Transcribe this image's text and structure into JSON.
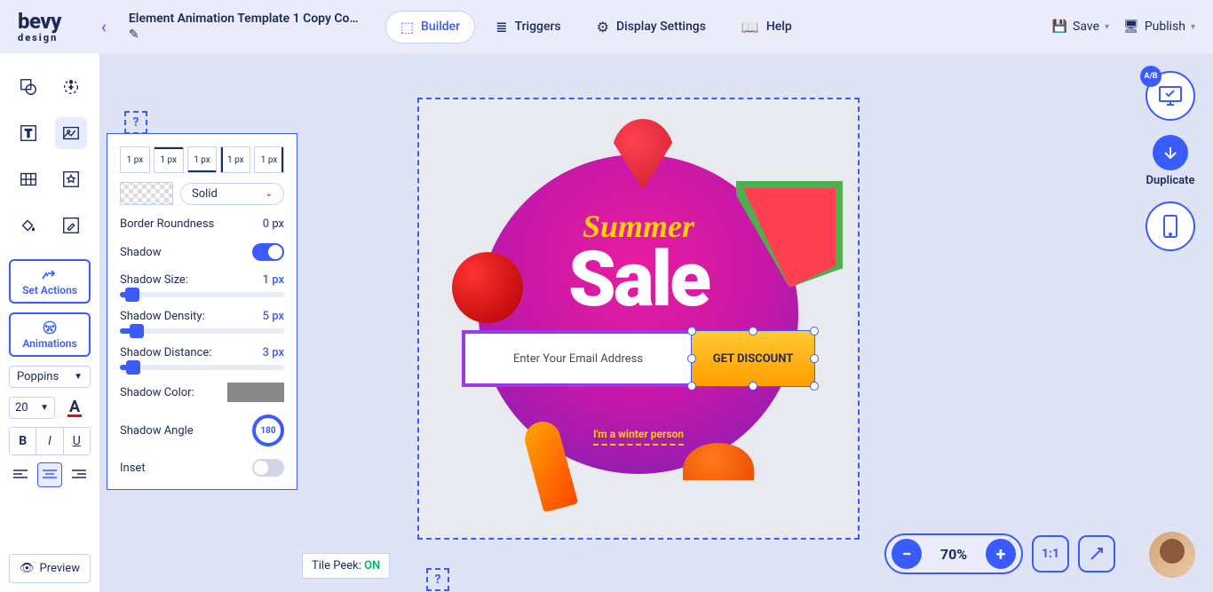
{
  "logo": {
    "top": "bevy",
    "sub": "design"
  },
  "title": "Element Animation Template 1 Copy Cop...",
  "tabs": [
    {
      "label": "Builder"
    },
    {
      "label": "Triggers"
    },
    {
      "label": "Display Settings"
    },
    {
      "label": "Help"
    }
  ],
  "topRight": {
    "save": "Save",
    "publish": "Publish"
  },
  "side": {
    "setActions": "Set Actions",
    "animations": "Animations",
    "font": "Poppins",
    "size": "20",
    "preview": "Preview"
  },
  "panel": {
    "bw": [
      "1 px",
      "1 px",
      "1 px",
      "1 px",
      "1 px"
    ],
    "style": "Solid",
    "roundness": {
      "label": "Border Roundness",
      "val": "0",
      "unit": "px"
    },
    "shadow": "Shadow",
    "shadowSize": {
      "label": "Shadow Size:",
      "val": "1 px"
    },
    "shadowDensity": {
      "label": "Shadow Density:",
      "val": "5 px"
    },
    "shadowDistance": {
      "label": "Shadow Distance:",
      "val": "3 px"
    },
    "shadowColor": "Shadow Color:",
    "shadowAngle": {
      "label": "Shadow Angle",
      "val": "180"
    },
    "inset": "Inset"
  },
  "tilepeek": {
    "label": "Tile Peek: ",
    "val": "ON"
  },
  "design": {
    "summer": "Summer",
    "sale": "Sale",
    "email": "Enter Your Email Address",
    "btn": "GET DISCOUNT",
    "winter": "I'm a winter person"
  },
  "float": {
    "ab": "A/B",
    "dup": "Duplicate"
  },
  "zoom": {
    "val": "70%",
    "ratio": "1:1"
  }
}
